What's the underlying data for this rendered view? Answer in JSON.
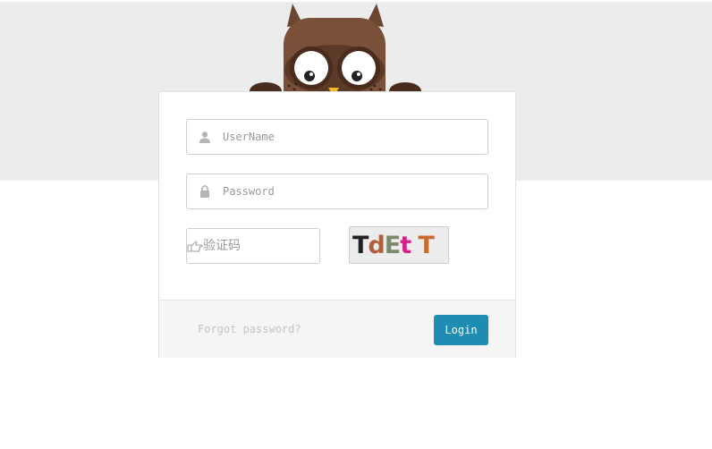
{
  "form": {
    "username_placeholder": "UserName",
    "password_placeholder": "Password",
    "captcha_placeholder": "验证码"
  },
  "captcha": {
    "chars": [
      {
        "char": "T",
        "color": "#222222"
      },
      {
        "char": "d",
        "color": "#b0603a"
      },
      {
        "char": "E",
        "color": "#7a8a6a"
      },
      {
        "char": "t",
        "color": "#d4218c"
      },
      {
        "char": " ",
        "color": "#000000"
      },
      {
        "char": "T",
        "color": "#c86a2e"
      }
    ]
  },
  "footer": {
    "forgot_label": "Forgot password?",
    "login_label": "Login"
  },
  "icons": {
    "username": "user-icon",
    "password": "lock-icon",
    "captcha": "hand-pointing-icon"
  },
  "colors": {
    "accent": "#1f8cb3",
    "band": "#ececec"
  }
}
